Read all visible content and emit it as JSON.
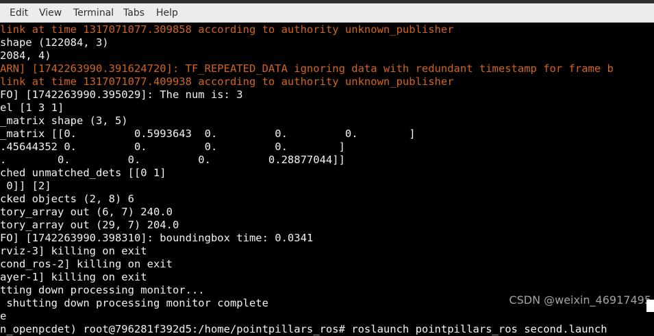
{
  "menubar": {
    "items": [
      "Edit",
      "View",
      "Terminal",
      "Tabs",
      "Help"
    ]
  },
  "terminal": {
    "lines": [
      {
        "text": "link at time 1317071077.309858 according to authority unknown_publisher",
        "kind": "warn"
      },
      {
        "text": "shape (122084, 3)",
        "kind": "normal"
      },
      {
        "text": "2084, 4)",
        "kind": "normal"
      },
      {
        "text": "ARN] [1742263990.391624720]: TF_REPEATED_DATA ignoring data with redundant timestamp for frame b",
        "kind": "warn"
      },
      {
        "text": "link at time 1317071077.409938 according to authority unknown_publisher",
        "kind": "warn"
      },
      {
        "text": "FO] [1742263990.395029]: The num is: 3",
        "kind": "normal"
      },
      {
        "text": "el [1 3 1]",
        "kind": "normal"
      },
      {
        "text": "_matrix shape (3, 5)",
        "kind": "normal"
      },
      {
        "text": "_matrix [[0.         0.5993643  0.         0.         0.        ]",
        "kind": "normal"
      },
      {
        "text": ".45644352 0.         0.         0.         0.        ]",
        "kind": "normal"
      },
      {
        "text": ".        0.         0.         0.         0.28877044]]",
        "kind": "normal"
      },
      {
        "text": "ched unmatched_dets [[0 1]",
        "kind": "normal"
      },
      {
        "text": " 0]] [2]",
        "kind": "normal"
      },
      {
        "text": "cked objects (2, 8) 6",
        "kind": "normal"
      },
      {
        "text": "tory_array out (6, 7) 240.0",
        "kind": "normal"
      },
      {
        "text": "tory_array out (29, 7) 204.0",
        "kind": "normal"
      },
      {
        "text": "FO] [1742263990.398310]: boundingbox time: 0.0341",
        "kind": "normal"
      },
      {
        "text": "rviz-3] killing on exit",
        "kind": "normal"
      },
      {
        "text": "cond_ros-2] killing on exit",
        "kind": "normal"
      },
      {
        "text": "ayer-1] killing on exit",
        "kind": "normal"
      },
      {
        "text": "tting down processing monitor...",
        "kind": "normal"
      },
      {
        "text": " shutting down processing monitor complete",
        "kind": "normal"
      },
      {
        "text": "e",
        "kind": "normal"
      },
      {
        "text": "n_openpcdet) root@796281f392d5:/home/pointpillars_ros# roslaunch pointpillars_ros second.launch",
        "kind": "normal"
      }
    ]
  },
  "watermark": {
    "text": "CSDN @weixin_46917495"
  },
  "colors": {
    "warn": "#d0651e",
    "normal": "#f2f2f2",
    "background": "#000000"
  }
}
